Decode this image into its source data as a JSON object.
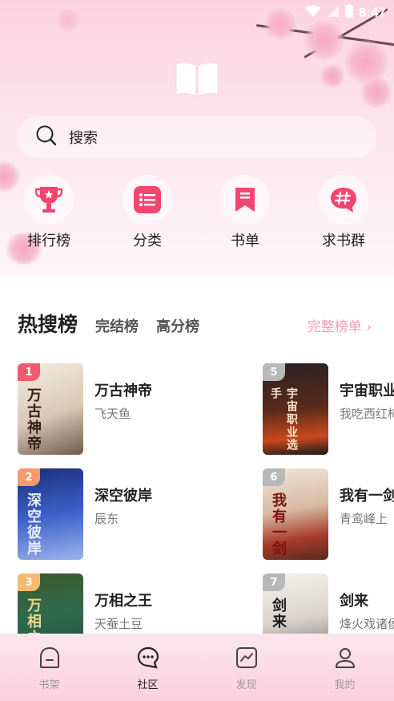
{
  "status_bar": {
    "time": "8:47"
  },
  "search": {
    "placeholder": "搜索"
  },
  "quick_links": [
    {
      "label": "排行榜",
      "icon": "trophy-icon"
    },
    {
      "label": "分类",
      "icon": "list-icon"
    },
    {
      "label": "书单",
      "icon": "bookmark-icon"
    },
    {
      "label": "求书群",
      "icon": "hashtag-chat-icon"
    }
  ],
  "ranking": {
    "main_tab": "热搜榜",
    "tabs": [
      "完结榜",
      "高分榜"
    ],
    "full_list_label": "完整榜单 ›",
    "books": [
      {
        "rank": "1",
        "title": "万古神帝",
        "author": "飞天鱼",
        "cover_text": "万古神帝"
      },
      {
        "rank": "2",
        "title": "深空彼岸",
        "author": "辰东",
        "cover_text": "深空彼岸"
      },
      {
        "rank": "3",
        "title": "万相之王",
        "author": "天蚕土豆",
        "cover_text": "万相之王"
      },
      {
        "rank": "5",
        "title": "宇宙职业",
        "author": "我吃西红柿",
        "cover_text": "宇宙职业选手"
      },
      {
        "rank": "6",
        "title": "我有一剑",
        "author": "青鸾峰上",
        "cover_text": "我有一剑"
      },
      {
        "rank": "7",
        "title": "剑来",
        "author": "烽火戏诸侯",
        "cover_text": "剑来"
      }
    ]
  },
  "bottom_nav": [
    {
      "label": "书架",
      "icon": "bookshelf-icon",
      "active": false
    },
    {
      "label": "社区",
      "icon": "chat-bubble-icon",
      "active": true
    },
    {
      "label": "发现",
      "icon": "trend-chart-icon",
      "active": false
    },
    {
      "label": "我的",
      "icon": "person-icon",
      "active": false
    }
  ],
  "colors": {
    "accent": "#f2456f",
    "link": "#f59bb3",
    "rank_top": "#f25a6f",
    "rank_other": "#b8b8b8"
  }
}
